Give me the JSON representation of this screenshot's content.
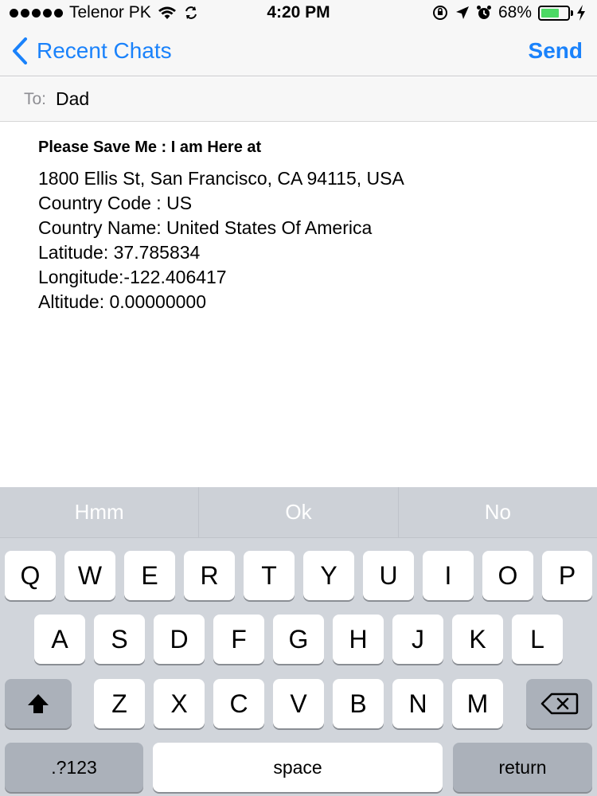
{
  "status_bar": {
    "carrier": "Telenor PK",
    "time": "4:20 PM",
    "battery_percent": "68%",
    "battery_level": 0.68
  },
  "nav": {
    "back_label": "Recent Chats",
    "send_label": "Send"
  },
  "to_field": {
    "label": "To:",
    "value": "Dad"
  },
  "message": {
    "title": "Please Save Me : I am Here at",
    "lines": [
      "1800 Ellis St, San Francisco, CA 94115, USA",
      "Country Code : US",
      "Country Name: United States Of America",
      "Latitude: 37.785834",
      "Longitude:-122.406417",
      "Altitude: 0.00000000"
    ]
  },
  "keyboard": {
    "suggestions": [
      "Hmm",
      "Ok",
      "No"
    ],
    "row1": [
      "Q",
      "W",
      "E",
      "R",
      "T",
      "Y",
      "U",
      "I",
      "O",
      "P"
    ],
    "row2": [
      "A",
      "S",
      "D",
      "F",
      "G",
      "H",
      "J",
      "K",
      "L"
    ],
    "row3": [
      "Z",
      "X",
      "C",
      "V",
      "B",
      "N",
      "M"
    ],
    "numbers_label": ".?123",
    "space_label": "space",
    "return_label": "return"
  },
  "colors": {
    "accent": "#1a82fb",
    "battery": "#4cd964"
  }
}
